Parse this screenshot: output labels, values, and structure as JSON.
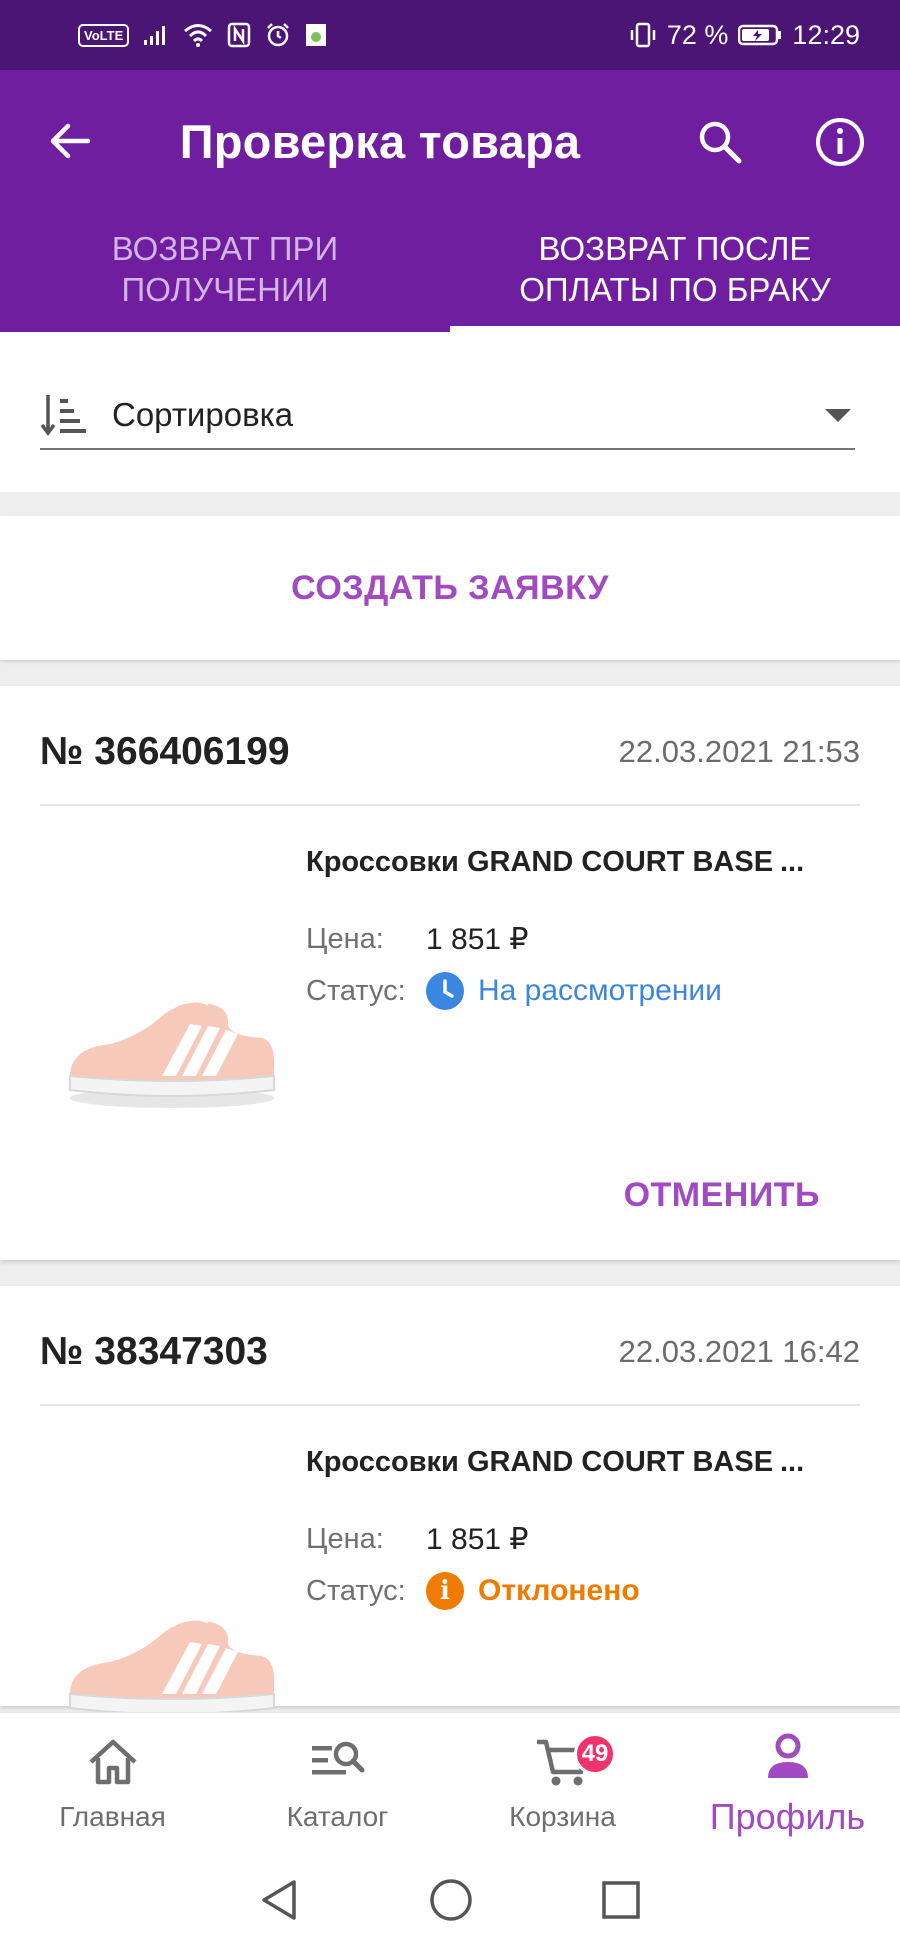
{
  "status_bar": {
    "volte": "VoLTE",
    "battery_percent": "72 %",
    "time": "12:29"
  },
  "appbar": {
    "title": "Проверка товара"
  },
  "tabs": [
    {
      "label_line1": "ВОЗВРАТ ПРИ",
      "label_line2": "ПОЛУЧЕНИИ",
      "active": false
    },
    {
      "label_line1": "ВОЗВРАТ ПОСЛЕ",
      "label_line2": "ОПЛАТЫ ПО БРАКУ",
      "active": true
    }
  ],
  "sort": {
    "label": "Сортировка"
  },
  "create_request": {
    "label": "СОЗДАТЬ ЗАЯВКУ"
  },
  "orders": [
    {
      "number": "№ 366406199",
      "date": "22.03.2021 21:53",
      "product_name": "Кроссовки GRAND COURT BASE",
      "ellipsis": "...",
      "price_label": "Цена:",
      "price": "1 851 ₽",
      "status_label": "Статус:",
      "status": "На рассмотрении",
      "status_type": "pending",
      "status_color": "#3a86e0",
      "cancel_label": "ОТМЕНИТЬ"
    },
    {
      "number": "№ 38347303",
      "date": "22.03.2021 16:42",
      "product_name": "Кроссовки GRAND COURT BASE",
      "ellipsis": "...",
      "price_label": "Цена:",
      "price": "1 851 ₽",
      "status_label": "Статус:",
      "status": "Отклонено",
      "status_type": "rejected",
      "status_color": "#ef7c00",
      "rejected_icon_glyph": "i"
    }
  ],
  "bottom_nav": [
    {
      "label": "Главная",
      "icon": "home-icon",
      "active": false
    },
    {
      "label": "Каталог",
      "icon": "catalog-search-icon",
      "active": false
    },
    {
      "label": "Корзина",
      "icon": "cart-icon",
      "active": false,
      "badge": "49"
    },
    {
      "label": "Профиль",
      "icon": "profile-icon",
      "active": true
    }
  ],
  "colors": {
    "status_bar": "#4a1574",
    "app_bar": "#6f1ea0",
    "accent": "#a24ac2",
    "badge": "#f0336a"
  }
}
